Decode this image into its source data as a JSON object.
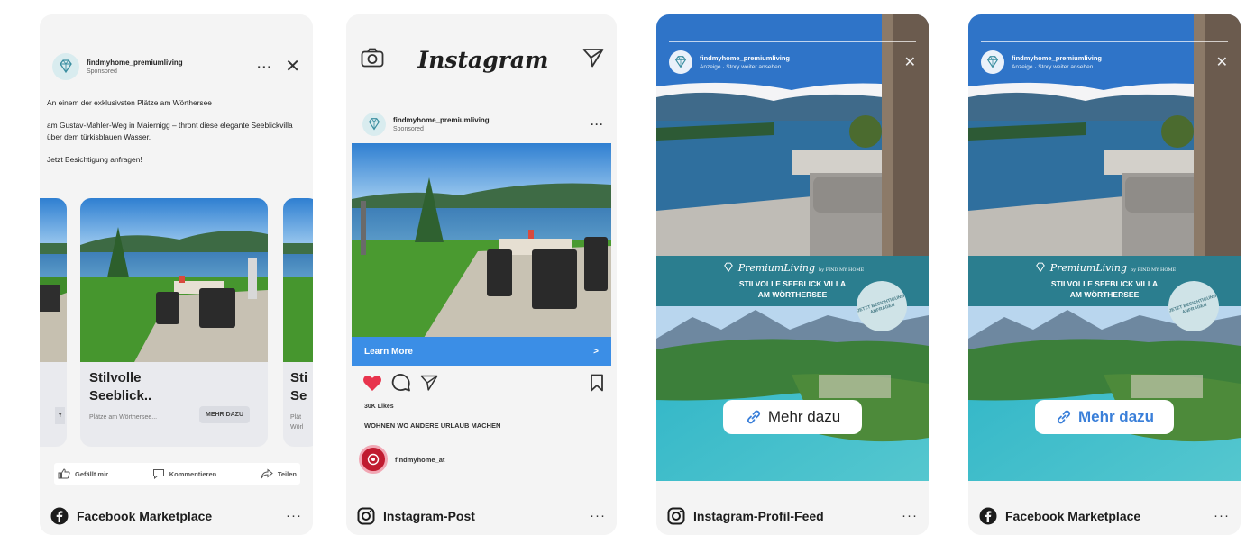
{
  "account": {
    "name": "findmyhome_premiumliving",
    "sponsored": "Sponsored",
    "story_sub": "Anzeige · Story weiter ansehen"
  },
  "fb_carousel": {
    "dots": "···",
    "text": [
      "An einem der exklusivsten Plätze am Wörthersee",
      "am Gustav-Mahler-Weg in Maiernigg – thront diese elegante Seeblickvilla über dem türkisblauen Wasser.",
      "Jetzt Besichtigung anfragen!"
    ],
    "card_title": "Stilvolle Seeblick..",
    "card_sub": "Plätze am Wörthersee...",
    "card_button": "MEHR DAZU",
    "peek_right_title": "Sti\nSe",
    "peek_right_sub": "Plät\nWörl",
    "actions": [
      "Gefällt mir",
      "Kommentieren",
      "Teilen"
    ],
    "footer_label": "Facebook Marketplace"
  },
  "ig_post": {
    "logo": "Instagram",
    "cta": "Learn More",
    "cta_arrow": ">",
    "likes": "30K Likes",
    "caption": "WOHNEN WO ANDERE URLAUB MACHEN",
    "profile": "findmyhome_at",
    "footer_label": "Instagram-Post"
  },
  "story_1": {
    "brand": "PremiumLiving",
    "brand_by": "by FIND MY HOME",
    "headline_1": "STILVOLLE SEEBLICK VILLA",
    "headline_2": "AM WÖRTHERSEE",
    "badge": "JETZT BESICHTIGUNG ANFRAGEN",
    "cta": "Mehr dazu",
    "footer_label": "Instagram-Profil-Feed"
  },
  "story_2": {
    "brand": "PremiumLiving",
    "brand_by": "by FIND MY HOME",
    "headline_1": "STILVOLLE SEEBLICK VILLA",
    "headline_2": "AM WÖRTHERSEE",
    "badge": "JETZT BESICHTIGUNG ANFRAGEN",
    "cta": "Mehr dazu",
    "footer_label": "Facebook Marketplace"
  },
  "footer_more": "···",
  "colors": {
    "card_bg": "#f4f4f4",
    "instagram_cta": "#3b8ee6",
    "story_band": "#2b7e8f",
    "like_heart": "#e8344d",
    "link_blue": "#3a7fd9"
  },
  "icons": [
    "diamond-logo-icon",
    "close-icon",
    "more-icon",
    "camera-icon",
    "send-icon",
    "heart-icon",
    "comment-icon",
    "bookmark-icon",
    "like-icon",
    "share-icon",
    "facebook-icon",
    "instagram-icon",
    "link-icon"
  ]
}
